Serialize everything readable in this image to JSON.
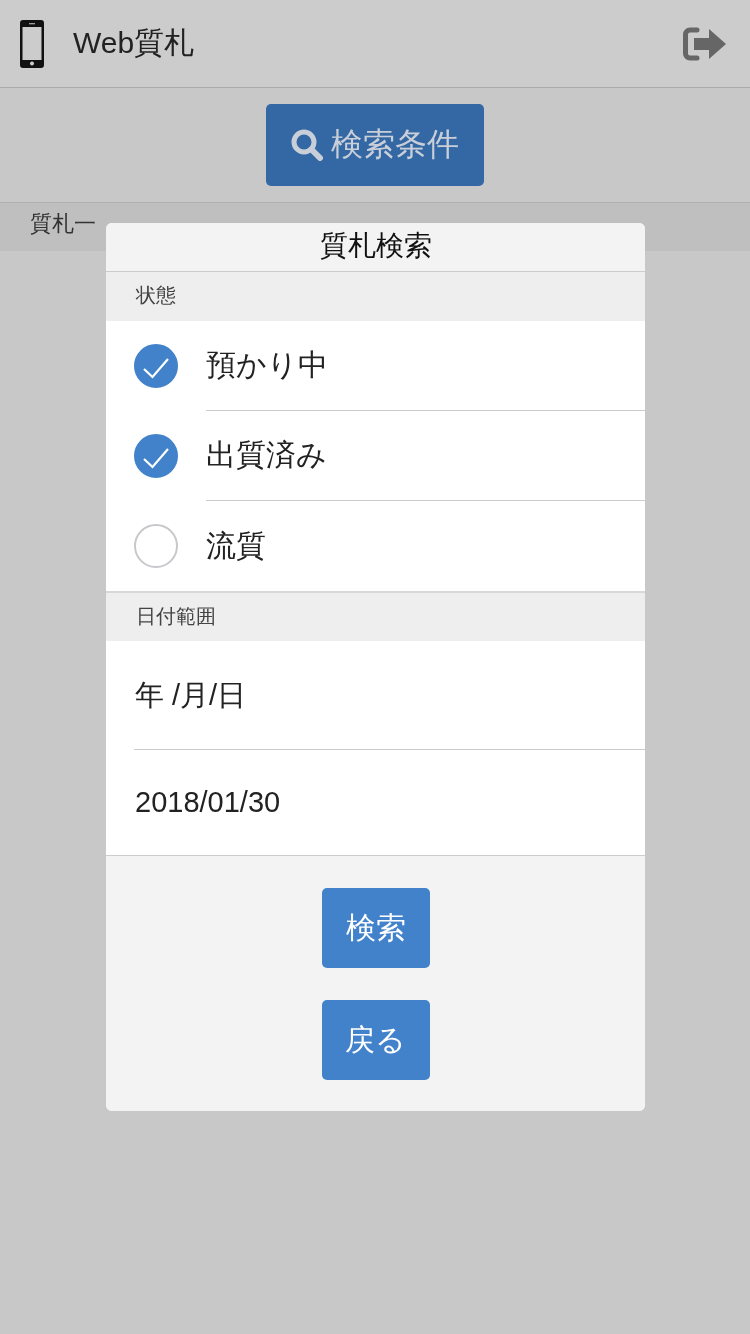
{
  "header": {
    "title": "Web質札"
  },
  "toolbar": {
    "search_button": {
      "label": "検索条件"
    }
  },
  "list_bar": {
    "title": "質札一"
  },
  "dialog": {
    "title": "質札検索",
    "status": {
      "heading": "状態",
      "options": [
        {
          "label": "預かり中",
          "checked": true
        },
        {
          "label": "出質済み",
          "checked": true
        },
        {
          "label": "流質",
          "checked": false
        }
      ]
    },
    "date_range": {
      "heading": "日付範囲",
      "fields": [
        {
          "placeholder": "年 /月/日"
        },
        {
          "value": "2018/01/30"
        }
      ]
    },
    "buttons": [
      {
        "label": "検索"
      },
      {
        "label": "戻る"
      }
    ]
  }
}
